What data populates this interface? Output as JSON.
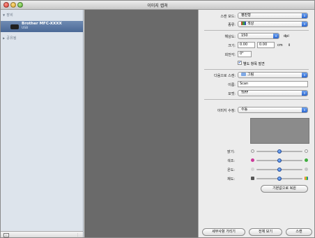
{
  "window": {
    "title": "이미지 캡쳐"
  },
  "sidebar": {
    "devices_heading": "장비",
    "device": {
      "name": "Brother MFC-XXXX",
      "connection": "USB"
    },
    "shared_heading": "공유됨"
  },
  "settings": {
    "scan_mode": {
      "label": "스캔 모드:",
      "value": "평판형"
    },
    "kind": {
      "label": "종류:",
      "value": "색상"
    },
    "resolution": {
      "label": "해상도:",
      "value": "150",
      "unit": "dpi"
    },
    "size": {
      "label": "크기:",
      "width": "0.00",
      "height": "0.00",
      "unit": "cm"
    },
    "rotation": {
      "label": "회전각:",
      "value": "0°"
    },
    "separate_items": {
      "label": "별도 항목 발견",
      "checked": true
    },
    "scan_to": {
      "label": "다음으로 스캔:",
      "value": "그림"
    },
    "name": {
      "label": "이름:",
      "value": "Scan"
    },
    "format": {
      "label": "포맷:",
      "value": "TIFF"
    },
    "image_correction": {
      "label": "이미지 수정:",
      "value": "수동"
    }
  },
  "adjustments": {
    "brightness": {
      "label": "밝기:",
      "level": 0.5
    },
    "tint": {
      "label": "색조:",
      "level": 0.5
    },
    "temperature": {
      "label": "온도:",
      "level": 0.5
    },
    "saturation": {
      "label": "채도:",
      "level": 0.5
    },
    "restore_defaults": "기본값으로 복원"
  },
  "footer": {
    "hide_details": "세부사항 가리기",
    "overview": "전체 보기",
    "scan": "스캔"
  },
  "colors": {
    "accent": "#2a66d0",
    "preview_bg": "#6a6a6a",
    "sidebar_bg": "#dde4ec",
    "selected_device": "#4a6896"
  }
}
